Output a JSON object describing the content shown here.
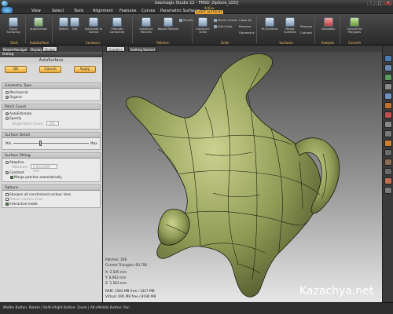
{
  "window": {
    "title": "Geomagic Studio 12 -  FMSD_Zipfone_LOD]",
    "context_header": "Active",
    "controls": [
      "–",
      "□",
      "×"
    ]
  },
  "menu": {
    "items": [
      "View",
      "Select",
      "Tools",
      "Alignment",
      "Features",
      "Curves",
      "Parametric Surfaces"
    ],
    "active_tab": "Exact Surfaces"
  },
  "ribbon": {
    "buttons": [
      {
        "label": "Exact Surfacing",
        "icon": "surface-icon"
      },
      {
        "label": "AutoSurface",
        "icon": "autosurface-icon"
      },
      {
        "label": "Detect",
        "icon": "detect-icon"
      },
      {
        "label": "Edit",
        "icon": "edit-icon"
      },
      {
        "label": "Subdivide or Extend",
        "icon": "subdivide-icon"
      },
      {
        "label": "Promote Constraint",
        "icon": "promote-icon"
      },
      {
        "label": "Construct Patches",
        "icon": "construct-icon"
      },
      {
        "label": "Repair Patches",
        "icon": "repair-icon"
      },
      {
        "label": "Construct Grids",
        "icon": "grid-icon"
      },
      {
        "label": "Fit Surfaces",
        "icon": "fit-icon"
      },
      {
        "label": "Merge Surfaces",
        "icon": "merge-icon"
      },
      {
        "label": "Deviation",
        "icon": "deviation-icon"
      },
      {
        "label": "Convert to Polygons",
        "icon": "convert-icon"
      }
    ],
    "small_buttons": [
      "Shuffle",
      "Move Curves",
      "Close All",
      "Edit Grids",
      "Remove",
      "Geometric",
      "Remove",
      "Convert"
    ],
    "groups": [
      "Start",
      "AutoSurface",
      "Contours",
      "Patches",
      "Grids",
      "Surfaces",
      "Analysis",
      "Convert"
    ]
  },
  "left_panel": {
    "tabs": [
      "Model Manager",
      "Display",
      "Dialog"
    ],
    "dialog_bar": "Dialog",
    "dialog_title": "AutoSurface",
    "buttons": {
      "ok": "OK",
      "cancel": "Cancel",
      "apply": "Apply"
    },
    "geometry_type": {
      "header": "Geometry Type",
      "options": [
        "Mechanical",
        "Organic"
      ],
      "selected": "Organic"
    },
    "patch_count": {
      "header": "Patch Count",
      "options": [
        "AutoEstimate",
        "Specify"
      ],
      "selected": "AutoEstimate",
      "target_label": "Target Patch Count",
      "target_value": "100"
    },
    "surface_detail": {
      "header": "Surface Detail",
      "min": "Min",
      "max": "Max",
      "level": 0.35
    },
    "surface_fitting": {
      "header": "Surface Fitting",
      "options": [
        "Adaptive",
        "Constant"
      ],
      "selected": "Constant",
      "tolerance_label": "Tolerance",
      "tolerance_value": "0.0014399 mm",
      "checkbox": "Merge patches automatically"
    },
    "options": {
      "header": "Options",
      "items": [
        {
          "label": "Sharpen all constrained contour lines",
          "checked": false,
          "enabled": true
        },
        {
          "label": "Detect contour lines",
          "checked": false,
          "enabled": false
        },
        {
          "label": "Interactive mode",
          "checked": true,
          "enabled": true
        }
      ]
    }
  },
  "viewport": {
    "tabs": [
      "Graphics",
      "Getting Started"
    ],
    "stats": [
      "Patches: 108",
      "Current Triangles: 60,756",
      "X: 2.505 mm",
      "Y: 8.962 mm",
      "Z: 1.563 mm",
      "RAM: 1583 MB free / 3327 MB",
      "Virtual: 695 MB free / 8190 MB"
    ],
    "watermark": "Kazachya.net"
  },
  "status_bar": {
    "text": "Middle Button: Rotate  |  Shift+Right Button: Zoom  |  Alt+Middle Button: Pan"
  },
  "colors": {
    "accent": "#f0a030",
    "model_fill": "#8f9a55",
    "patch_lines": "#1c1c10"
  }
}
